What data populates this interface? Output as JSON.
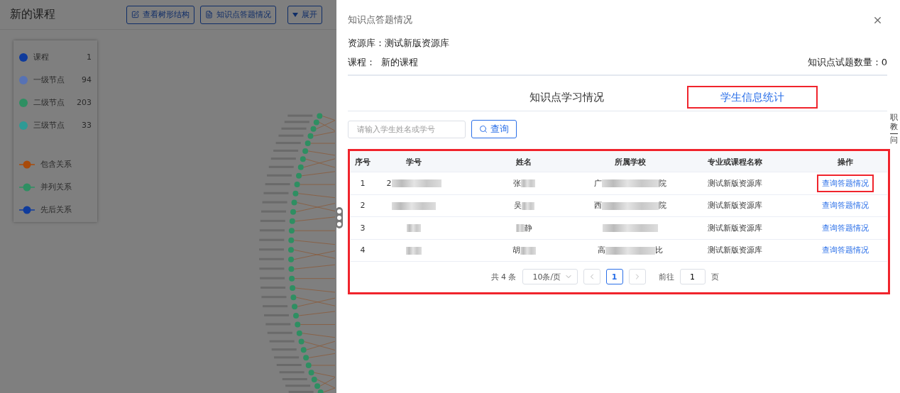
{
  "page": {
    "title": "新的课程",
    "toolbar": [
      {
        "label": "查看树形结构"
      },
      {
        "label": "知识点答题情况"
      },
      {
        "label": "展开"
      }
    ]
  },
  "legend": {
    "nodes": [
      {
        "label": "课程",
        "count": "1",
        "color": "#0f3b9c"
      },
      {
        "label": "一级节点",
        "count": "94",
        "color": "#5772b4"
      },
      {
        "label": "二级节点",
        "count": "203",
        "color": "#2e8f62"
      },
      {
        "label": "三级节点",
        "count": "33",
        "color": "#2e9a95"
      }
    ],
    "links": [
      {
        "label": "包含关系",
        "color": "#a84a0a"
      },
      {
        "label": "并列关系",
        "color": "#2e8f62"
      },
      {
        "label": "先后关系",
        "color": "#0f3b9c"
      }
    ]
  },
  "drawer": {
    "title": "知识点答题情况",
    "library": "资源库：测试新版资源库",
    "course": "课程：  新的课程",
    "question_count": "知识点试题数量：0",
    "tabs": [
      {
        "label": "知识点学习情况",
        "selected": false,
        "highlighted": false
      },
      {
        "label": "学生信息统计",
        "selected": true,
        "highlighted": true
      }
    ],
    "search": {
      "placeholder": "请输入学生姓名或学号",
      "button": "查询"
    },
    "side_text": [
      "职",
      "教",
      "问"
    ],
    "table": {
      "highlighted": true,
      "columns": [
        "序号",
        "学号",
        "姓名",
        "所属学校",
        "专业或课程名称",
        "操作"
      ],
      "rows": [
        {
          "index": "1",
          "student_id": {
            "kind": "blurred",
            "prefix": "2"
          },
          "name": {
            "kind": "blurred",
            "prefix": "张"
          },
          "school": {
            "kind": "blurred",
            "prefix": "广",
            "suffix": "院"
          },
          "major": "测试新版资源库",
          "action": "查询答题情况",
          "action_highlighted": true
        },
        {
          "index": "2",
          "student_id": {
            "kind": "blurred"
          },
          "name": {
            "kind": "blurred",
            "prefix": "吴"
          },
          "school": {
            "kind": "blurred",
            "prefix": "西",
            "suffix": "院"
          },
          "major": "测试新版资源库",
          "action": "查询答题情况",
          "action_highlighted": false
        },
        {
          "index": "3",
          "student_id": {
            "kind": "blurred"
          },
          "name": {
            "kind": "blurred",
            "suffix": "静"
          },
          "school": {
            "kind": "blurred"
          },
          "major": "测试新版资源库",
          "action": "查询答题情况",
          "action_highlighted": false
        },
        {
          "index": "4",
          "student_id": {
            "kind": "blurred"
          },
          "name": {
            "kind": "blurred",
            "prefix": "胡"
          },
          "school": {
            "kind": "blurred",
            "prefix": "高",
            "suffix": "比"
          },
          "major": "测试新版资源库",
          "action": "查询答题情况",
          "action_highlighted": false
        }
      ]
    },
    "pagination": {
      "total": "共 4 条",
      "page_size": "10条/页",
      "pages": [
        {
          "label": "1",
          "selected": true
        }
      ],
      "goto_label": "前往",
      "goto_value": "1",
      "goto_unit": "页"
    }
  }
}
